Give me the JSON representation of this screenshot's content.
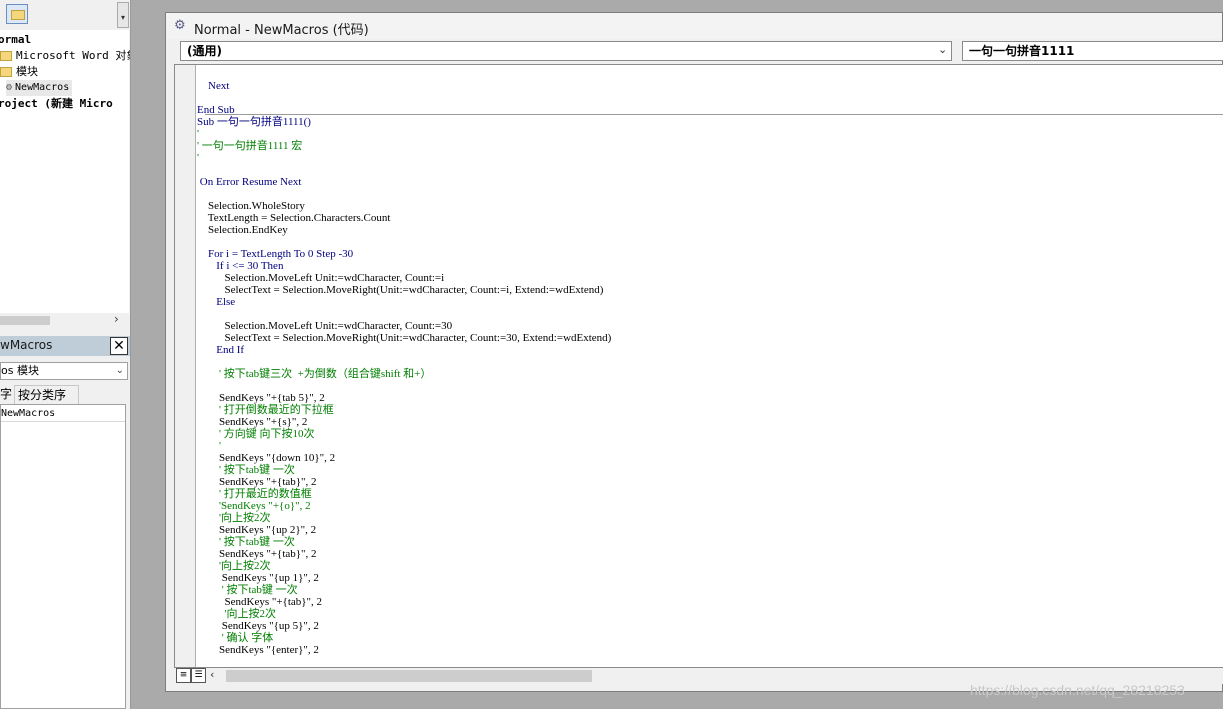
{
  "explorer": {
    "tree": [
      {
        "text": "ormal"
      },
      {
        "text": "Microsoft Word 对象"
      },
      {
        "text": "模块"
      },
      {
        "text": "NewMacros"
      },
      {
        "text": "roject (新建 Micro"
      }
    ]
  },
  "properties": {
    "title": "wMacros",
    "combo_value": "os 模块",
    "tab_alpha": "字",
    "tab_categorized": "按分类序",
    "row_name": "NewMacros"
  },
  "code_window": {
    "title": "Normal - NewMacros (代码)",
    "object_combo": "(通用)",
    "procedure_combo": "一句一句拼音1111"
  },
  "code": {
    "lines": [
      {
        "text": "    Next",
        "style": "kw"
      },
      {
        "text": "End Sub",
        "style": "kw"
      },
      {
        "text": "Sub 一句一句拼音1111()",
        "style": "kw"
      },
      {
        "text": "'",
        "style": "cmt"
      },
      {
        "text": "' 一句一句拼音1111 宏",
        "style": "cmt"
      },
      {
        "text": "'",
        "style": "cmt"
      },
      {
        "text": " On Error Resume Next",
        "style": "kw"
      },
      {
        "text": "    Selection.WholeStory",
        "style": ""
      },
      {
        "text": "    TextLength = Selection.Characters.Count",
        "style": ""
      },
      {
        "text": "    Selection.EndKey",
        "style": ""
      },
      {
        "text": "    For i = TextLength To 0 Step -30",
        "style": "kw"
      },
      {
        "text": "       If i <= 30 Then",
        "style": "kw"
      },
      {
        "text": "          Selection.MoveLeft Unit:=wdCharacter, Count:=i",
        "style": ""
      },
      {
        "text": "          SelectText = Selection.MoveRight(Unit:=wdCharacter, Count:=i, Extend:=wdExtend)",
        "style": ""
      },
      {
        "text": "       Else",
        "style": "kw"
      },
      {
        "text": "          Selection.MoveLeft Unit:=wdCharacter, Count:=30",
        "style": ""
      },
      {
        "text": "          SelectText = Selection.MoveRight(Unit:=wdCharacter, Count:=30, Extend:=wdExtend)",
        "style": ""
      },
      {
        "text": "       End If",
        "style": "kw"
      },
      {
        "text": "        ' 按下tab键三次  +为倒数（组合键shift 和+）",
        "style": "cmt"
      },
      {
        "text": "        SendKeys \"+{tab 5}\", 2",
        "style": ""
      },
      {
        "text": "        ' 打开倒数最近的下拉框",
        "style": "cmt"
      },
      {
        "text": "        SendKeys \"+{s}\", 2",
        "style": ""
      },
      {
        "text": "        ' 方向键 向下按10次",
        "style": "cmt"
      },
      {
        "text": "        '",
        "style": "cmt"
      },
      {
        "text": "        SendKeys \"{down 10}\", 2",
        "style": ""
      },
      {
        "text": "        ' 按下tab键 一次",
        "style": "cmt"
      },
      {
        "text": "        SendKeys \"+{tab}\", 2",
        "style": ""
      },
      {
        "text": "        ' 打开最近的数值框",
        "style": "cmt"
      },
      {
        "text": "        'SendKeys \"+{o}\", 2",
        "style": "cmt"
      },
      {
        "text": "        '向上按2次",
        "style": "cmt"
      },
      {
        "text": "        SendKeys \"{up 2}\", 2",
        "style": ""
      },
      {
        "text": "        ' 按下tab键 一次",
        "style": "cmt"
      },
      {
        "text": "        SendKeys \"+{tab}\", 2",
        "style": ""
      },
      {
        "text": "        '向上按2次",
        "style": "cmt"
      },
      {
        "text": "         SendKeys \"{up 1}\", 2",
        "style": ""
      },
      {
        "text": "         ' 按下tab键 一次",
        "style": "cmt"
      },
      {
        "text": "          SendKeys \"+{tab}\", 2",
        "style": ""
      },
      {
        "text": "          '向上按2次",
        "style": "cmt"
      },
      {
        "text": "         SendKeys \"{up 5}\", 2",
        "style": ""
      },
      {
        "text": "         ' 确认 字体",
        "style": "cmt"
      },
      {
        "text": "        SendKeys \"{enter}\", 2",
        "style": ""
      }
    ]
  },
  "watermark": "https://blog.csdn.net/qq_28218253"
}
